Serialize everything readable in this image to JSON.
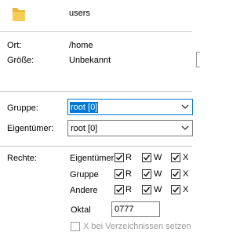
{
  "folder": {
    "name": "users",
    "icon": "folder-icon"
  },
  "info": {
    "location_label": "Ort:",
    "location_value": "/home",
    "size_label": "Größe:",
    "size_value": "Unbekannt"
  },
  "group": {
    "label": "Gruppe:",
    "value": "root [0]"
  },
  "owner": {
    "label": "Eigentümer:",
    "value": "root [0]"
  },
  "permissions": {
    "label": "Rechte:",
    "rows": [
      {
        "name": "Eigentümer",
        "r": true,
        "w": true,
        "x": true
      },
      {
        "name": "Gruppe",
        "r": true,
        "w": true,
        "x": true
      },
      {
        "name": "Andere",
        "r": true,
        "w": true,
        "x": true
      }
    ],
    "r_label": "R",
    "w_label": "W",
    "x_label": "X",
    "octal_label": "Oktal",
    "octal_value": "0777"
  },
  "recursive_option": {
    "label": "X bei Verzeichnissen setzen",
    "checked": false
  }
}
